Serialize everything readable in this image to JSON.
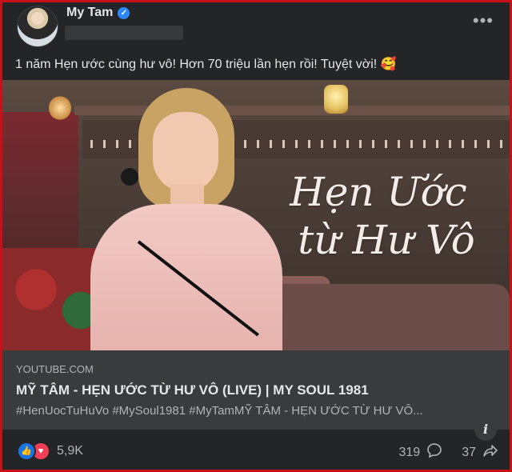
{
  "post": {
    "author": "My Tam",
    "verified_icon": "verified-badge-icon",
    "more_label": "•••",
    "caption": "1 năm Hẹn ước cùng hư vô! Hơn 70 triệu lần hẹn rồi! Tuyệt vời! 🥰"
  },
  "media": {
    "art_line1": "Hẹn Ước",
    "art_line2": "từ Hư Vô",
    "info_label": "i"
  },
  "link": {
    "domain": "YOUTUBE.COM",
    "title": "MỸ TÂM - HẸN ƯỚC TỪ HƯ VÔ (LIVE) | MY SOUL 1981",
    "description": "#HenUocTuHuVo #MySoul1981 #MyTamMỸ TÂM - HẸN ƯỚC TỪ HƯ VÔ..."
  },
  "footer": {
    "like_glyph": "👍",
    "love_glyph": "♥",
    "reaction_count": "5,9K",
    "comment_count": "319",
    "share_count": "37"
  },
  "colors": {
    "border": "#c8101a",
    "card_bg": "#242526",
    "link_bg": "#3a3b3c",
    "like_blue": "#1b74e4",
    "love_red": "#f33e58"
  }
}
